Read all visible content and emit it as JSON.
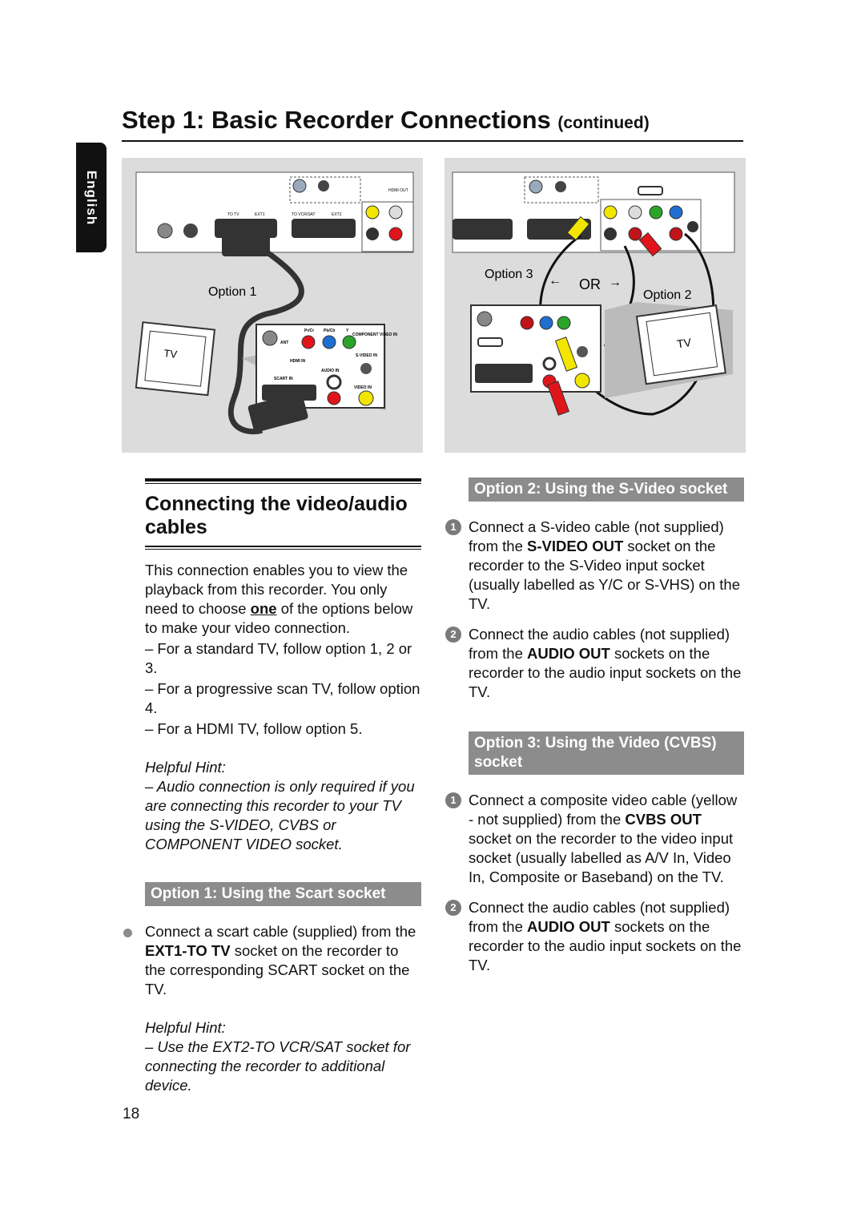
{
  "header": {
    "title": "Step 1: Basic Recorder Connections",
    "title_suffix": "(continued)",
    "language_tab": "English"
  },
  "figures": {
    "left": {
      "option_label": "Option 1",
      "tv_label": "TV",
      "recorder_labels": [
        "TO TV",
        "EXT1",
        "TO VCR/SAT",
        "EXT2",
        "HDMI OUT"
      ],
      "tv_panel_labels": [
        "ANT",
        "Pr/Cr",
        "Pb/Cb",
        "Y",
        "COMPONENT VIDEO IN",
        "HDMI IN",
        "S-VIDEO IN",
        "AUDIO IN",
        "SCART IN",
        "VIDEO IN"
      ]
    },
    "right": {
      "option3_label": "Option 3",
      "or_label": "OR",
      "option2_label": "Option 2",
      "tv_label": "TV"
    }
  },
  "left_column": {
    "section_title": "Connecting the video/audio cables",
    "intro_1": "This connection enables you to view the playback from this recorder. You only need to choose ",
    "intro_emph": "one",
    "intro_2": " of the options below to make your video connection.",
    "list": [
      "–  For a standard TV, follow option 1, 2 or 3.",
      "–  For a progressive scan TV, follow option 4.",
      "–  For a HDMI TV, follow option 5."
    ],
    "hint1_title": "Helpful Hint:",
    "hint1_text": "– Audio connection is only required if you are connecting this recorder to your TV using the S-VIDEO, CVBS or COMPONENT VIDEO socket.",
    "option1": {
      "title": "Option 1: Using the Scart socket",
      "step_pre": "Connect a scart cable (supplied) from the ",
      "step_bold": "EXT1-TO TV",
      "step_post": " socket on the recorder to the corresponding SCART socket on the TV."
    },
    "hint2_title": "Helpful Hint:",
    "hint2_text": "– Use the EXT2-TO VCR/SAT socket for connecting the recorder to additional device."
  },
  "right_column": {
    "option2": {
      "title": "Option 2: Using the S-Video socket",
      "steps": [
        {
          "num": "1",
          "pre": "Connect a S-video cable (not supplied) from the ",
          "bold": "S-VIDEO OUT",
          "post": " socket on the recorder to the S-Video input socket (usually labelled as Y/C or S-VHS) on the TV."
        },
        {
          "num": "2",
          "pre": "Connect the audio cables (not supplied) from the ",
          "bold": "AUDIO OUT",
          "post": " sockets on the recorder to the audio input sockets on the TV."
        }
      ]
    },
    "option3": {
      "title": "Option 3: Using the Video (CVBS) socket",
      "steps": [
        {
          "num": "1",
          "pre": "Connect a composite video cable (yellow - not supplied) from the ",
          "bold": "CVBS OUT",
          "post": " socket on the recorder to the video input socket (usually labelled as A/V In, Video In, Composite or Baseband) on the TV."
        },
        {
          "num": "2",
          "pre": "Connect the audio cables (not supplied) from the ",
          "bold": "AUDIO OUT",
          "post": " sockets on the recorder to the audio input sockets on the TV."
        }
      ]
    }
  },
  "footer": {
    "page_number": "18"
  },
  "colors": {
    "option_bar": "#8c8c8c",
    "figure_bg": "#dcdcdc",
    "yellow": "#f2e600",
    "red": "#e0151b",
    "green": "#2aa52a",
    "blue": "#1f6fd0"
  }
}
